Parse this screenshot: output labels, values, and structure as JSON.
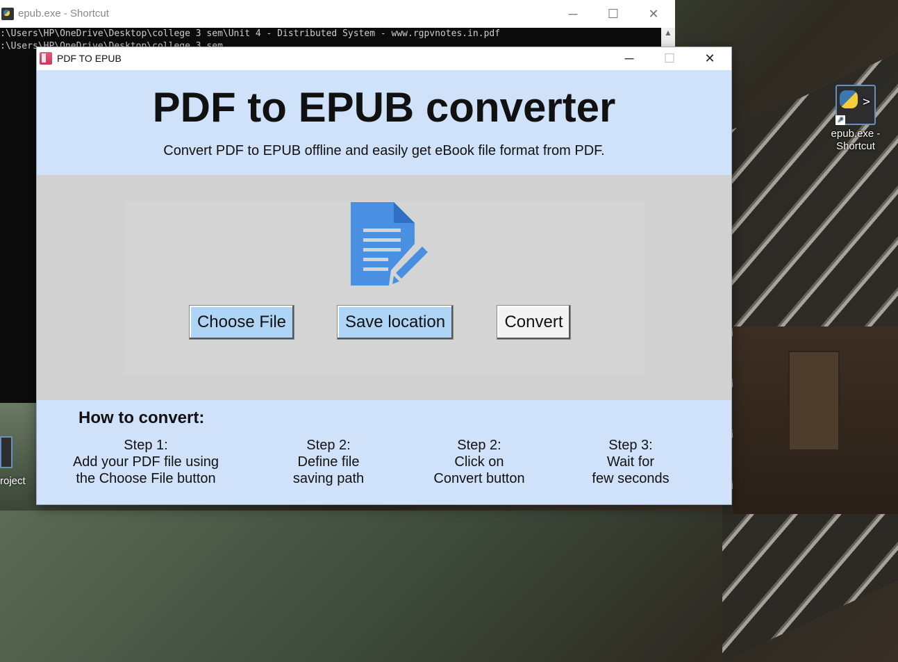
{
  "desktop": {
    "icon_right_label": "epub.exe - Shortcut",
    "icon_left_label": "roject"
  },
  "console": {
    "title": "epub.exe - Shortcut",
    "lines": [
      ":\\Users\\HP\\OneDrive\\Desktop\\college 3 sem\\Unit 4 - Distributed System - www.rgpvnotes.in.pdf",
      ":\\Users\\HP\\OneDrive\\Desktop\\college 3 sem"
    ],
    "minimize": "─",
    "maximize": "☐",
    "close": "✕"
  },
  "app": {
    "title": "PDF TO EPUB",
    "minimize": "─",
    "maximize": "☐",
    "close": "✕",
    "heading": "PDF to EPUB converter",
    "subheading": "Convert PDF to EPUB offline and easily get eBook file format from PDF.",
    "icon": "document-edit-icon",
    "accent_color": "#4a90e2",
    "buttons": {
      "choose": "Choose File",
      "save": "Save location",
      "convert": "Convert"
    },
    "howto_title": "How to convert:",
    "steps": [
      {
        "title": "Step 1:",
        "line1": "Add your PDF file using",
        "line2": "the Choose File button"
      },
      {
        "title": "Step 2:",
        "line1": "Define file",
        "line2": "saving path"
      },
      {
        "title": "Step 2:",
        "line1": "Click on",
        "line2": "Convert button"
      },
      {
        "title": "Step 3:",
        "line1": "Wait for",
        "line2": "few seconds"
      }
    ]
  }
}
